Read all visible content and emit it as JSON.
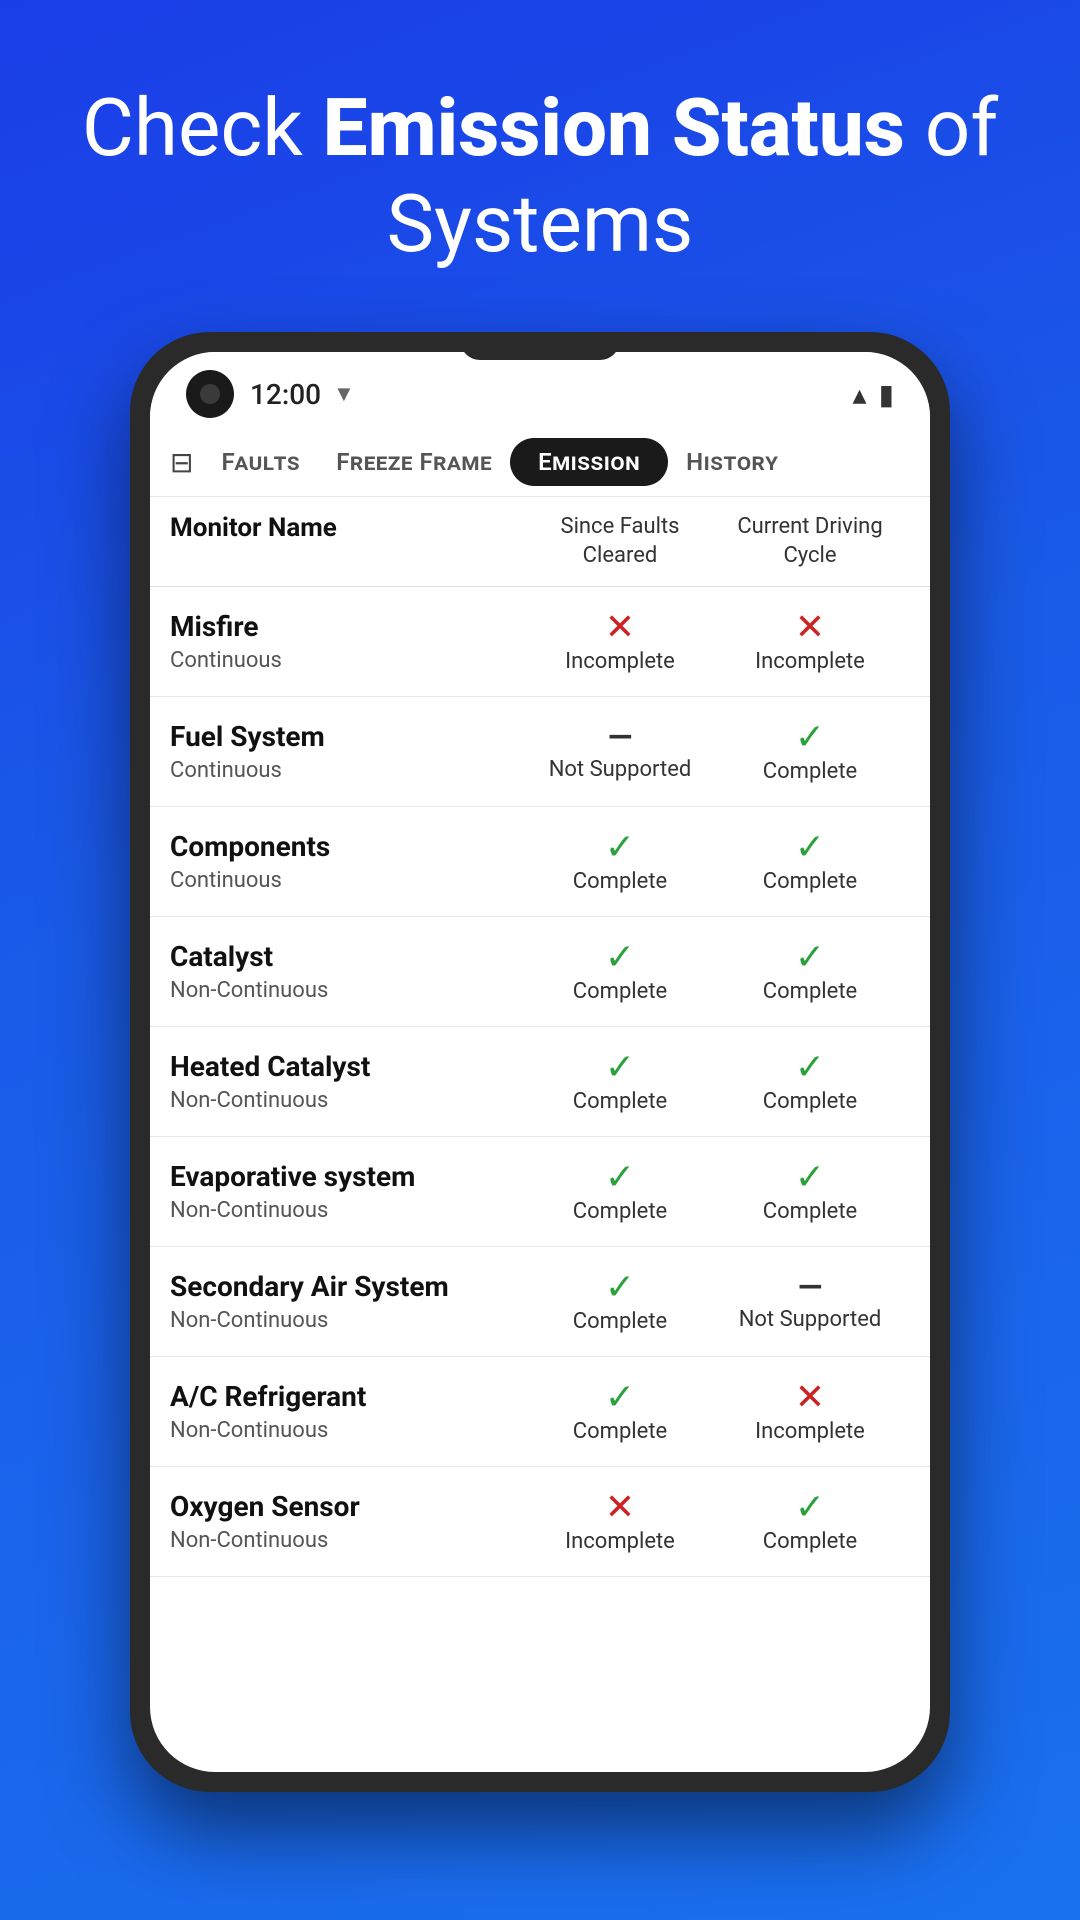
{
  "hero": {
    "line1": "Check ",
    "bold1": "Status",
    "line2": " of",
    "line3": " Systems",
    "bold2": "Emission"
  },
  "statusBar": {
    "time": "12:00"
  },
  "tabs": [
    {
      "id": "faults",
      "label": "Faults",
      "active": false
    },
    {
      "id": "freeze-frame",
      "label": "Freeze Frame",
      "active": false
    },
    {
      "id": "emission",
      "label": "Emission",
      "active": true
    },
    {
      "id": "history",
      "label": "History",
      "active": false
    }
  ],
  "tableHeader": {
    "monitorName": "Monitor Name",
    "sinceFaultsCleared": "Since Faults\nCleared",
    "currentDrivingCycle": "Current Driving\nCycle"
  },
  "rows": [
    {
      "name": "Misfire",
      "type": "Continuous",
      "sinceStatus": "incomplete",
      "sinceIcon": "x",
      "sinceLabel": "Incomplete",
      "currentStatus": "incomplete",
      "currentIcon": "x",
      "currentLabel": "Incomplete"
    },
    {
      "name": "Fuel System",
      "type": "Continuous",
      "sinceStatus": "not-supported",
      "sinceIcon": "dash",
      "sinceLabel": "Not Supported",
      "currentStatus": "complete",
      "currentIcon": "check",
      "currentLabel": "Complete"
    },
    {
      "name": "Components",
      "type": "Continuous",
      "sinceStatus": "complete",
      "sinceIcon": "check",
      "sinceLabel": "Complete",
      "currentStatus": "complete",
      "currentIcon": "check",
      "currentLabel": "Complete"
    },
    {
      "name": "Catalyst",
      "type": "Non-Continuous",
      "sinceStatus": "complete",
      "sinceIcon": "check",
      "sinceLabel": "Complete",
      "currentStatus": "complete",
      "currentIcon": "check",
      "currentLabel": "Complete"
    },
    {
      "name": "Heated Catalyst",
      "type": "Non-Continuous",
      "sinceStatus": "complete",
      "sinceIcon": "check",
      "sinceLabel": "Complete",
      "currentStatus": "complete",
      "currentIcon": "check",
      "currentLabel": "Complete"
    },
    {
      "name": "Evaporative system",
      "type": "Non-Continuous",
      "sinceStatus": "complete",
      "sinceIcon": "check",
      "sinceLabel": "Complete",
      "currentStatus": "complete",
      "currentIcon": "check",
      "currentLabel": "Complete"
    },
    {
      "name": "Secondary Air System",
      "type": "Non-Continuous",
      "sinceStatus": "complete",
      "sinceIcon": "check",
      "sinceLabel": "Complete",
      "currentStatus": "not-supported",
      "currentIcon": "dash",
      "currentLabel": "Not Supported"
    },
    {
      "name": "A/C Refrigerant",
      "type": "Non-Continuous",
      "sinceStatus": "complete",
      "sinceIcon": "check",
      "sinceLabel": "Complete",
      "currentStatus": "incomplete",
      "currentIcon": "x",
      "currentLabel": "Incomplete"
    },
    {
      "name": "Oxygen Sensor",
      "type": "Non-Continuous",
      "sinceStatus": "incomplete",
      "sinceIcon": "x",
      "sinceLabel": "Incomplete",
      "currentStatus": "complete",
      "currentIcon": "check",
      "currentLabel": "Complete"
    }
  ]
}
